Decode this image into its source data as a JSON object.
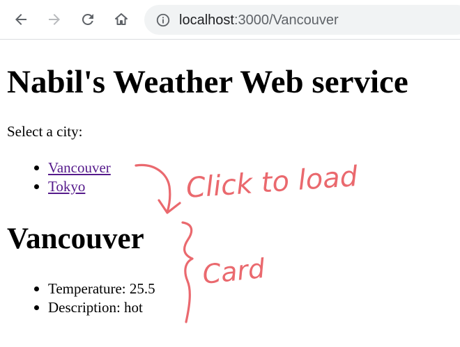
{
  "browser": {
    "url_host": "localhost",
    "url_path": ":3000/Vancouver",
    "back_icon": "arrow-left-icon",
    "forward_icon": "arrow-right-icon",
    "reload_icon": "reload-icon",
    "home_icon": "home-icon",
    "info_icon": "info-icon"
  },
  "page": {
    "title": "Nabil's Weather Web service",
    "prompt": "Select a city:",
    "cities": [
      {
        "label": "Vancouver"
      },
      {
        "label": "Tokyo"
      }
    ],
    "selected_city": "Vancouver",
    "details": [
      {
        "text": "Temperature: 25.5"
      },
      {
        "text": "Description: hot"
      }
    ]
  },
  "annotations": {
    "click_note": "Click to load",
    "card_note": "Card",
    "color": "#e8595f"
  }
}
